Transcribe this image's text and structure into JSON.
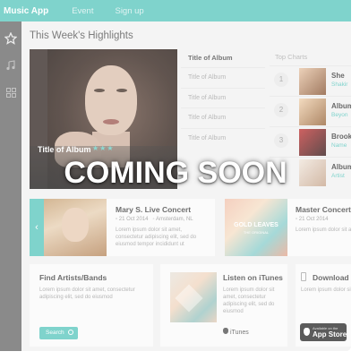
{
  "topbar": {
    "app_title": "Music App",
    "nav": [
      "Event",
      "Sign up"
    ]
  },
  "sidebar": {
    "icons": [
      "star-icon",
      "music-note-icon",
      "grid-icon"
    ]
  },
  "highlights": {
    "title": "This Week's Highlights",
    "hero_album_title": "Title of Album",
    "hero_rating": "★★★",
    "album_list": [
      "Title of Album",
      "Title of Album",
      "Title of Album",
      "Title of Album",
      "Title of Album"
    ]
  },
  "top_charts": {
    "title": "Top Charts",
    "items": [
      {
        "rank": "1",
        "name": "She",
        "sub": "Shakir"
      },
      {
        "rank": "2",
        "name": "Album",
        "sub": "Beyon"
      },
      {
        "rank": "3",
        "name": "Brook",
        "sub": "Name"
      },
      {
        "rank": "",
        "name": "Album",
        "sub": "Artist"
      }
    ]
  },
  "concerts": [
    {
      "title": "Mary S. Live Concert",
      "date": "21 Oct 2014",
      "place": "Amsterdam, NL",
      "text": "Lorem ipsum dolor sit amet, consectetur adipiscing elit, sed do eiusmod tempor incididunt ut"
    },
    {
      "title": "Master Concert",
      "date": "21 Oct 2014",
      "place": "",
      "text": "Lorem ipsum dolor sit amet, consectetur adipiscing elit, sed do eiusmod tempor incididunt ut"
    }
  ],
  "poster_text": {
    "line1": "GOLD LEAVES",
    "line2": "THE ORIGINAL"
  },
  "find_artists": {
    "title": "Find Artists/Bands",
    "text": "Lorem ipsum dolor sit amet, consectetur adipiscing elit, sed do eiusmod",
    "button": "Search"
  },
  "itunes": {
    "title": "Listen on iTunes",
    "text": "Lorem ipsum dolor sit amet, consectetur adipiscing elit, sed do eiusmod",
    "badge": "iTunes"
  },
  "download": {
    "title": "Download o",
    "text": "Lorem ipsum dolor sit amet, consectetur adipiscing elit, sed do eiusmod",
    "badge_small": "Available on the",
    "badge_big": "App Store"
  },
  "overlay_text": "COMING SOON",
  "colors": {
    "accent": "#5fc8c0",
    "sidebar": "#6d6d6d"
  }
}
